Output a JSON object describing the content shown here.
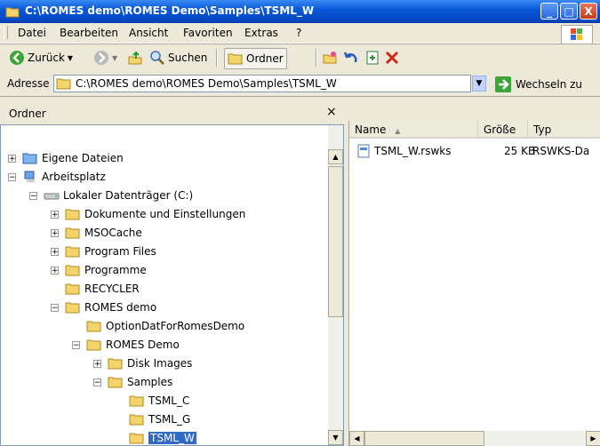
{
  "window": {
    "title": "C:\\ROMES demo\\ROMES Demo\\Samples\\TSML_W",
    "minimize": "_",
    "maximize": "□",
    "close": "X"
  },
  "menu": [
    {
      "label": "Datei"
    },
    {
      "label": "Bearbeiten"
    },
    {
      "label": "Ansicht"
    },
    {
      "label": "Favoriten"
    },
    {
      "label": "Extras"
    },
    {
      "label": "?"
    }
  ],
  "toolbar": {
    "back": "Zurück",
    "search": "Suchen",
    "folders": "Ordner"
  },
  "address": {
    "label": "Adresse",
    "value": "C:\\ROMES demo\\ROMES Demo\\Samples\\TSML_W",
    "go": "Wechseln zu"
  },
  "tree": {
    "title": "Ordner",
    "close": "×",
    "nodes": [
      {
        "label": "Eigene Dateien",
        "expander": "+"
      },
      {
        "label": "Arbeitsplatz",
        "expander": "−"
      },
      {
        "label": "Lokaler Datenträger (C:)",
        "expander": "−"
      },
      {
        "label": "Dokumente und Einstellungen",
        "expander": "+"
      },
      {
        "label": "MSOCache",
        "expander": "+"
      },
      {
        "label": "Program Files",
        "expander": "+"
      },
      {
        "label": "Programme",
        "expander": "+"
      },
      {
        "label": "RECYCLER",
        "expander": ""
      },
      {
        "label": "ROMES demo",
        "expander": "−"
      },
      {
        "label": "OptionDatForRomesDemo",
        "expander": ""
      },
      {
        "label": "ROMES Demo",
        "expander": "−"
      },
      {
        "label": "Disk Images",
        "expander": "+"
      },
      {
        "label": "Samples",
        "expander": "−"
      },
      {
        "label": "TSML_C",
        "expander": ""
      },
      {
        "label": "TSML_G",
        "expander": ""
      },
      {
        "label": "TSML_W",
        "expander": ""
      }
    ]
  },
  "list": {
    "columns": [
      "Name",
      "Größe",
      "Typ"
    ],
    "rows": [
      {
        "name": "TSML_W.rswks",
        "size": "25 KB",
        "type": "RSWKS-Da"
      }
    ]
  }
}
